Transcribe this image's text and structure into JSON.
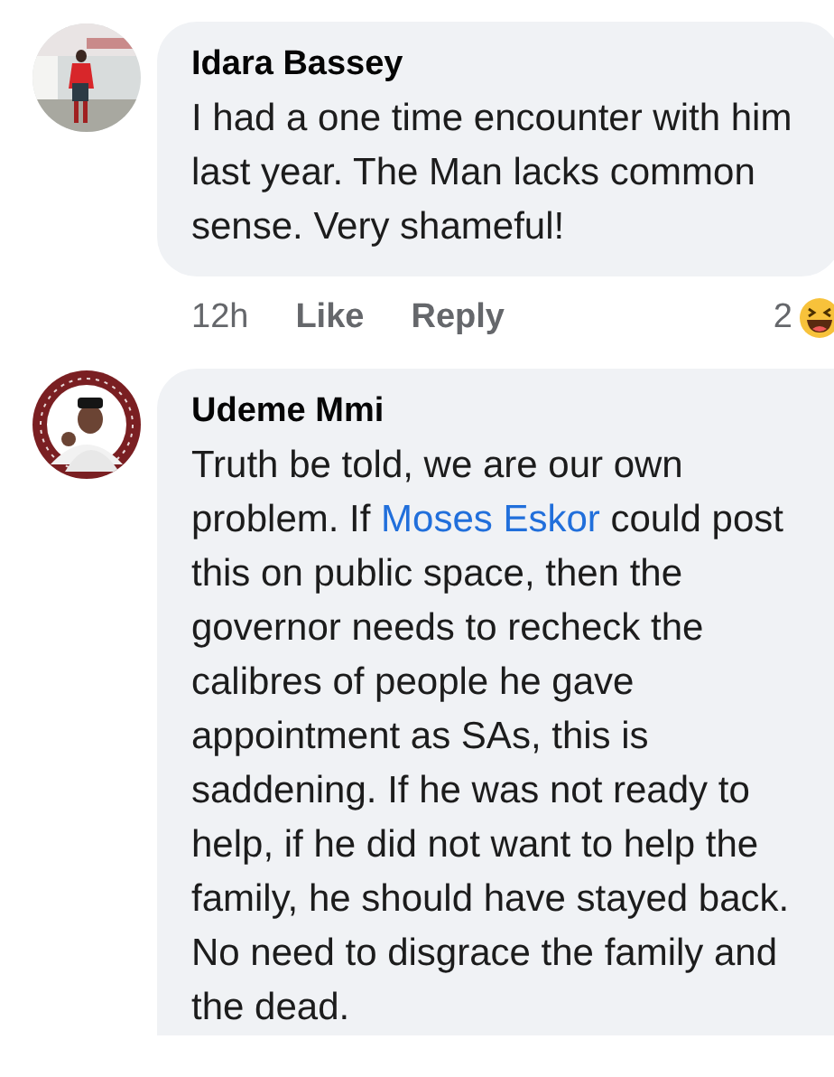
{
  "comments": [
    {
      "author": "Idara Bassey",
      "text": "I had a one time encounter with him last year. The Man lacks common sense. Very shameful!",
      "time": "12h",
      "actions": [
        "Like",
        "Reply"
      ],
      "reaction_count": "2"
    },
    {
      "author": "Udeme Mmi",
      "text_before": "Truth be told, we are our own problem. If ",
      "mention": "Moses Eskor",
      "text_after": " could post this on public space, then the governor needs to recheck the calibres of people he gave appointment as SAs, this is saddening. If he was not ready to help, if he did not want to help the family, he should have stayed back. No need to disgrace the family and the dead."
    }
  ]
}
